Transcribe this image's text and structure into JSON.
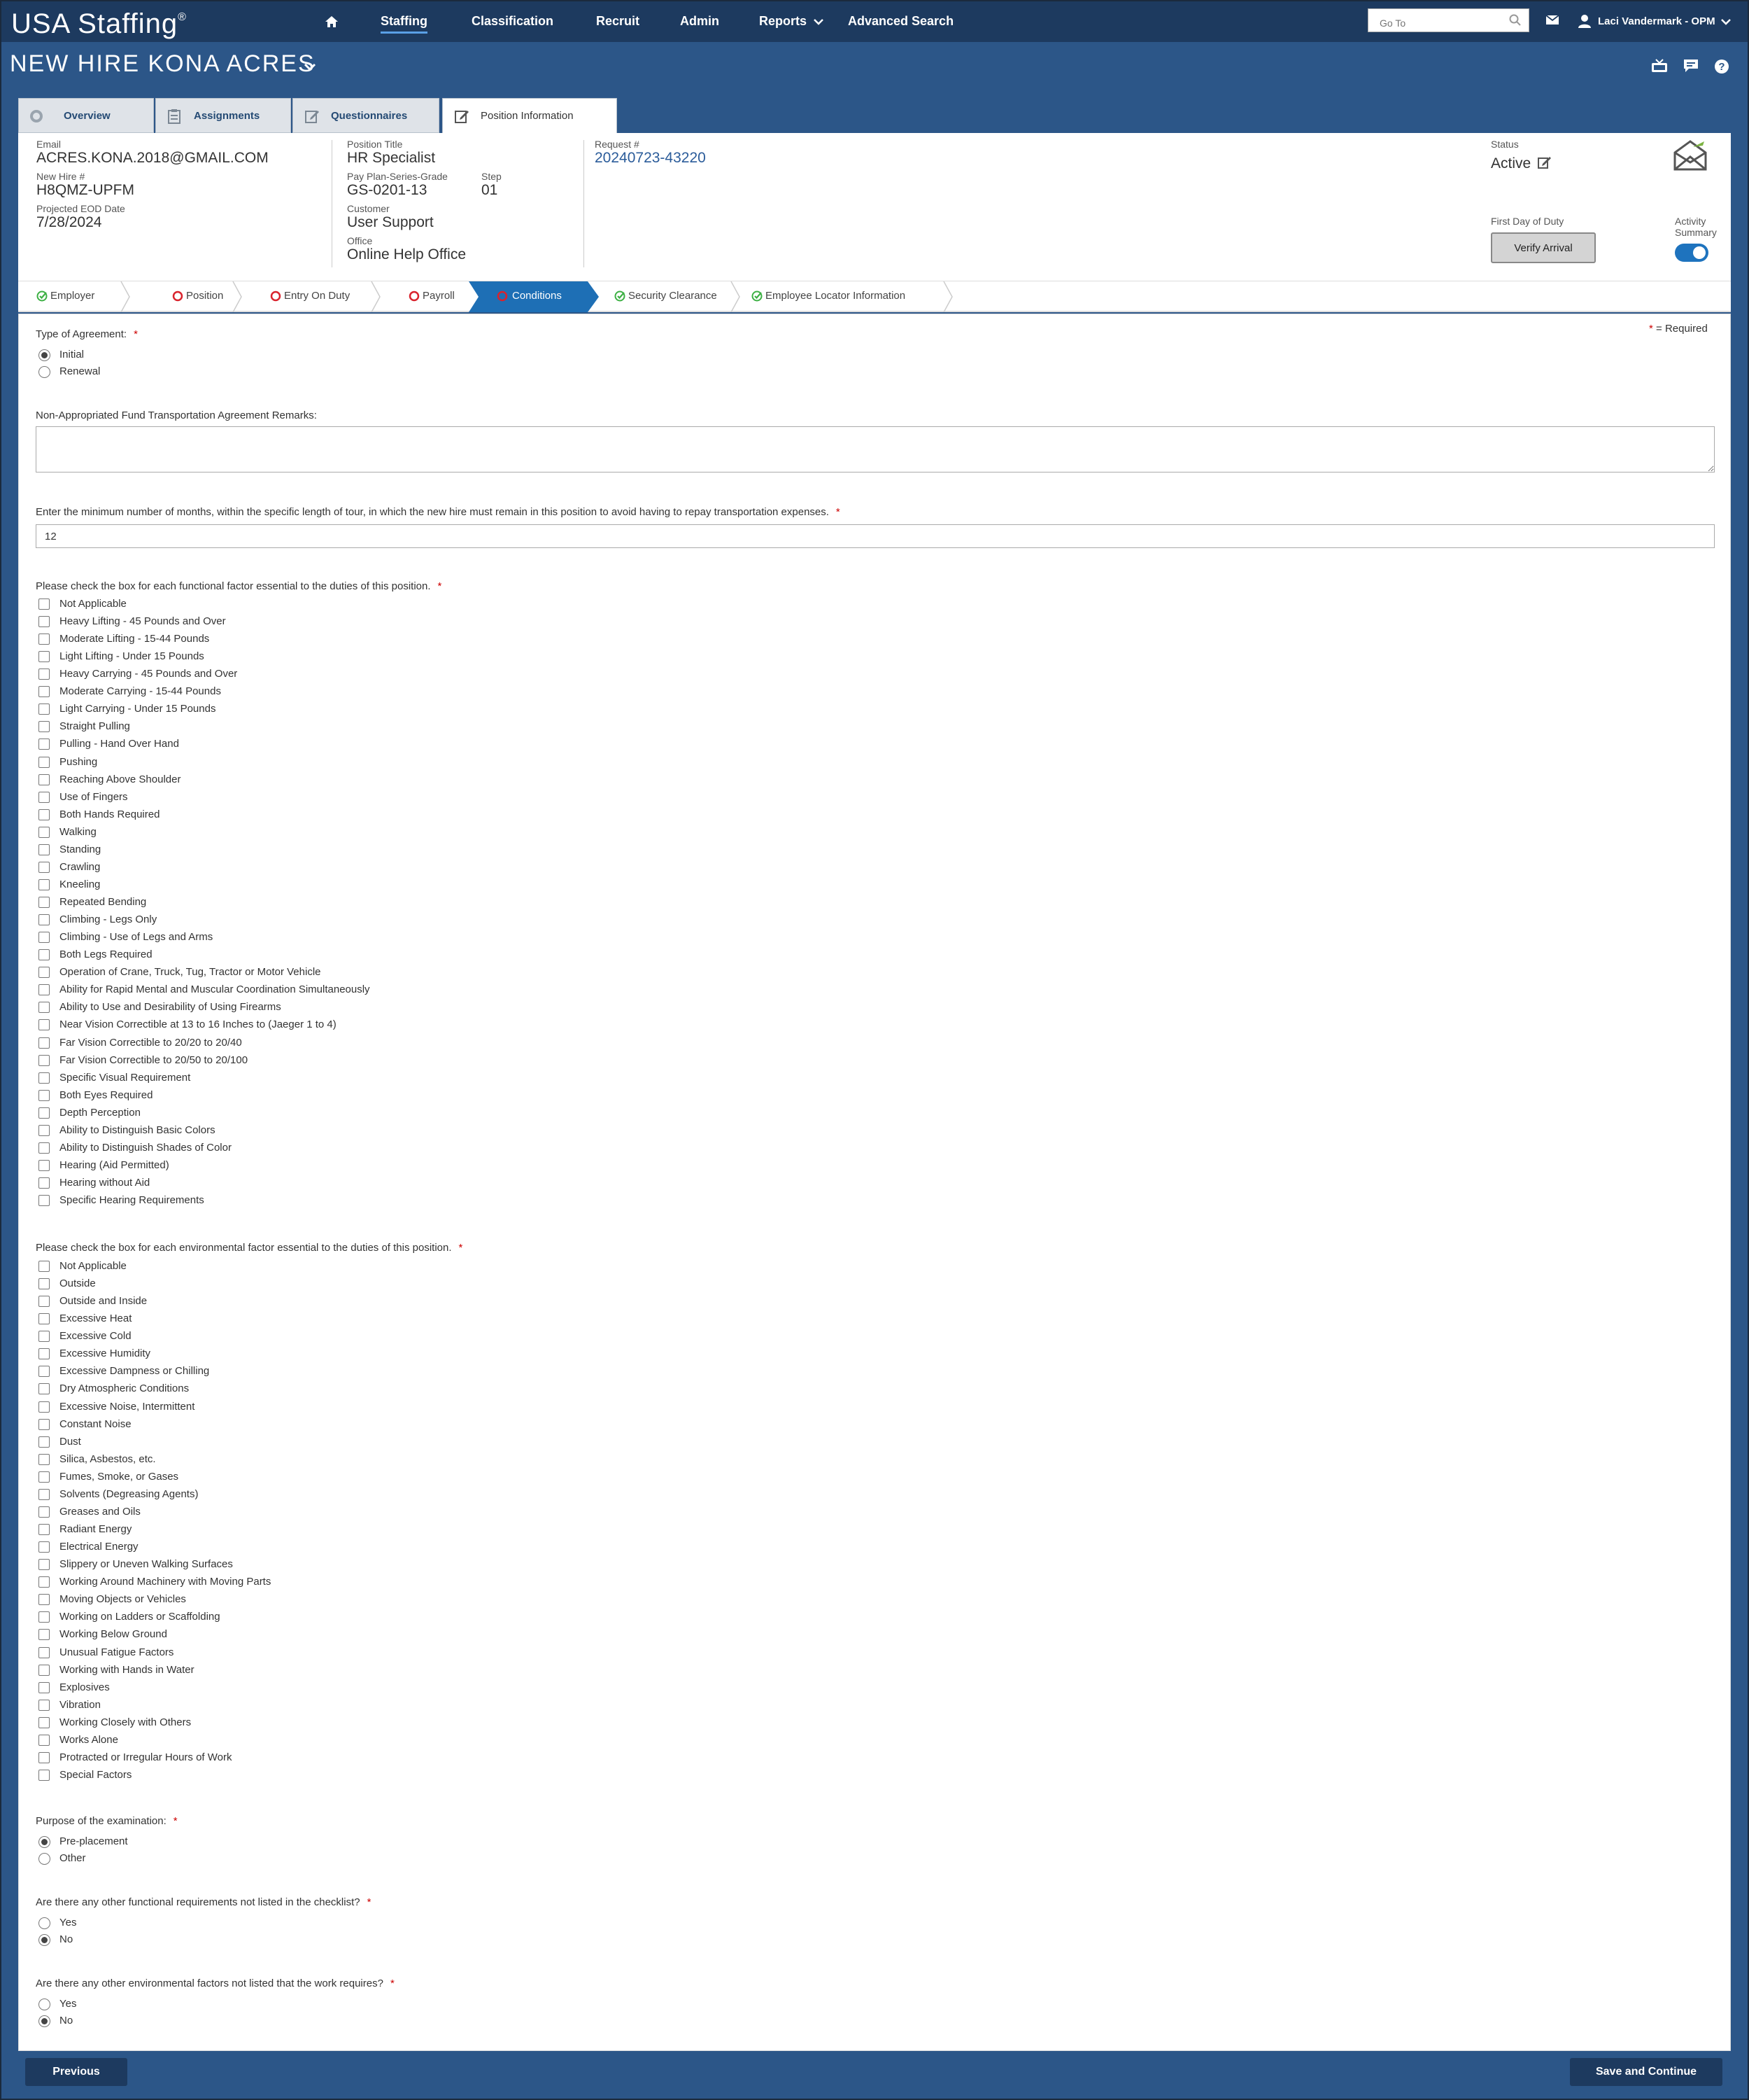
{
  "app": {
    "logo": "USA Staffing",
    "logo_mark": "®"
  },
  "nav": {
    "items": [
      "Staffing",
      "Classification",
      "Recruit",
      "Admin",
      "Reports",
      "Advanced Search"
    ],
    "goto_placeholder": "Go To",
    "user": "Laci Vandermark - OPM"
  },
  "header": {
    "title": "NEW HIRE KONA ACRES"
  },
  "tabs": [
    "Overview",
    "Assignments",
    "Questionnaires",
    "Position Information"
  ],
  "info": {
    "email_label": "Email",
    "email": "ACRES.KONA.2018@GMAIL.COM",
    "newhire_label": "New Hire #",
    "newhire": "H8QMZ-UPFM",
    "eod_label": "Projected EOD Date",
    "eod": "7/28/2024",
    "title_label": "Position Title",
    "title": "HR Specialist",
    "pay_label": "Pay Plan-Series-Grade",
    "pay": "GS-0201-13",
    "step_label": "Step",
    "step": "01",
    "customer_label": "Customer",
    "customer": "User Support",
    "office_label": "Office",
    "office": "Online Help Office",
    "request_label": "Request #",
    "request": "20240723-43220",
    "status_label": "Status",
    "status": "Active",
    "fdd_label": "First Day of Duty",
    "verify_button": "Verify Arrival",
    "activity_label_1": "Activity",
    "activity_label_2": "Summary"
  },
  "steps": [
    {
      "label": "Employer",
      "state": "complete"
    },
    {
      "label": "Position",
      "state": "incomplete"
    },
    {
      "label": "Entry On Duty",
      "state": "incomplete"
    },
    {
      "label": "Payroll",
      "state": "incomplete"
    },
    {
      "label": "Conditions",
      "state": "current"
    },
    {
      "label": "Security Clearance",
      "state": "complete"
    },
    {
      "label": "Employee Locator Information",
      "state": "complete"
    }
  ],
  "form": {
    "required_note": "= Required",
    "agreement_q": "Type of Agreement:",
    "agreement_opts": [
      "Initial",
      "Renewal"
    ],
    "agreement_selected": "Initial",
    "remarks_q": "Non-Appropriated Fund Transportation Agreement Remarks:",
    "months_q": "Enter the minimum number of months, within the specific length of tour, in which the new hire must remain in this position to avoid having to repay transportation expenses.",
    "months_value": "12",
    "functional_q": "Please check the box for each functional factor essential to the duties of this position.",
    "functional": [
      "Not Applicable",
      "Heavy Lifting - 45 Pounds and Over",
      "Moderate Lifting - 15-44 Pounds",
      "Light Lifting - Under 15 Pounds",
      "Heavy Carrying - 45 Pounds and Over",
      "Moderate Carrying - 15-44 Pounds",
      "Light Carrying - Under 15 Pounds",
      "Straight Pulling",
      "Pulling - Hand Over Hand",
      "Pushing",
      "Reaching Above Shoulder",
      "Use of Fingers",
      "Both Hands Required",
      "Walking",
      "Standing",
      "Crawling",
      "Kneeling",
      "Repeated Bending",
      "Climbing - Legs Only",
      "Climbing - Use of Legs and Arms",
      "Both Legs Required",
      "Operation of Crane, Truck, Tug, Tractor or Motor Vehicle",
      "Ability for Rapid Mental and Muscular Coordination Simultaneously",
      "Ability to Use and Desirability of Using Firearms",
      "Near Vision Correctible at 13 to 16 Inches to (Jaeger 1 to 4)",
      "Far Vision Correctible to 20/20 to 20/40",
      "Far Vision Correctible to 20/50 to 20/100",
      "Specific Visual Requirement",
      "Both Eyes Required",
      "Depth Perception",
      "Ability to Distinguish Basic Colors",
      "Ability to Distinguish Shades of Color",
      "Hearing (Aid Permitted)",
      "Hearing without Aid",
      "Specific Hearing Requirements"
    ],
    "environmental_q": "Please check the box for each environmental factor essential to the duties of this position.",
    "environmental": [
      "Not Applicable",
      "Outside",
      "Outside and Inside",
      "Excessive Heat",
      "Excessive Cold",
      "Excessive Humidity",
      "Excessive Dampness or Chilling",
      "Dry Atmospheric Conditions",
      "Excessive Noise, Intermittent",
      "Constant Noise",
      "Dust",
      "Silica, Asbestos, etc.",
      "Fumes, Smoke, or Gases",
      "Solvents (Degreasing Agents)",
      "Greases and Oils",
      "Radiant Energy",
      "Electrical Energy",
      "Slippery or Uneven Walking Surfaces",
      "Working Around Machinery with Moving Parts",
      "Moving Objects or Vehicles",
      "Working on Ladders or Scaffolding",
      "Working Below Ground",
      "Unusual Fatigue Factors",
      "Working with Hands in Water",
      "Explosives",
      "Vibration",
      "Working Closely with Others",
      "Works Alone",
      "Protracted or Irregular Hours of Work",
      "Special Factors"
    ],
    "purpose_q": "Purpose of the examination:",
    "purpose_opts": [
      "Pre-placement",
      "Other"
    ],
    "purpose_selected": "Pre-placement",
    "other_func_q": "Are there any other functional requirements not listed in the checklist?",
    "other_func_opts": [
      "Yes",
      "No"
    ],
    "other_func_selected": "No",
    "other_env_q": "Are there any other environmental factors not listed that the work requires?",
    "other_env_opts": [
      "Yes",
      "No"
    ],
    "other_env_selected": "No"
  },
  "buttons": {
    "previous": "Previous",
    "save": "Save and Continue"
  },
  "colors": {
    "nav_bg": "#1d3a5f",
    "page_bg": "#2c5688",
    "current_step": "#1e6fb5",
    "required": "#cc0000",
    "complete": "#3cb043",
    "incomplete": "#d9232d"
  },
  "icons": [
    "home-icon",
    "search-icon",
    "mail-icon",
    "user-icon",
    "tv-icon",
    "chat-icon",
    "help-icon",
    "overview-icon",
    "assignments-icon",
    "questionnaires-icon",
    "edit-icon",
    "envelope-logo-icon",
    "check-icon",
    "circle-icon"
  ]
}
